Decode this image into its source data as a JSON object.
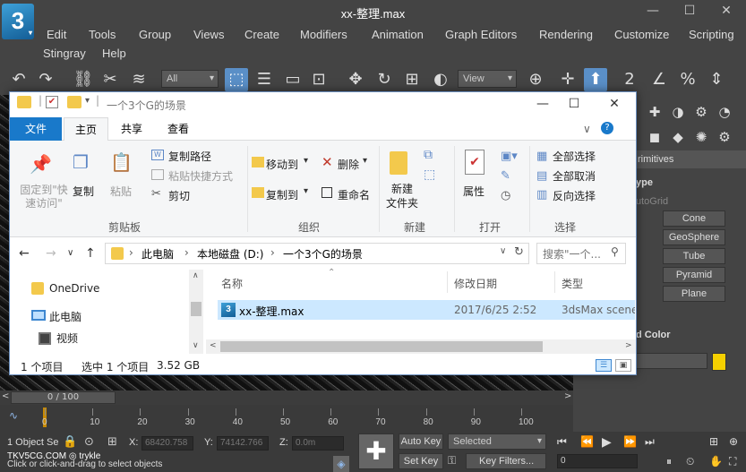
{
  "max": {
    "title": "xx-整理.max",
    "logo": "3",
    "window_controls": {
      "minimize": "—",
      "maximize": "☐",
      "close": "✕"
    },
    "menu": [
      "Edit",
      "Tools",
      "Group",
      "Views",
      "Create",
      "Modifiers",
      "Animation",
      "Graph Editors",
      "Rendering",
      "Customize",
      "Scripting",
      "Stingray",
      "Help"
    ],
    "toolbar": {
      "filter": "All",
      "view": "View"
    },
    "command_panel": {
      "rollout_primitives": "rimitives",
      "rollout_type": "ype",
      "autogrid": "utoGrid",
      "buttons": [
        "Cone",
        "GeoSphere",
        "Tube",
        "Pyramid",
        "Plane"
      ],
      "name_color": "d Color",
      "color_swatch": "#f5d000"
    },
    "timeslider": {
      "label": "0 / 100",
      "frame": 0,
      "frame_max": 100
    },
    "trackbar_ticks": [
      "0",
      "10",
      "20",
      "30",
      "40",
      "50",
      "60",
      "70",
      "80",
      "90",
      "100"
    ],
    "status": {
      "selection": "1 Object Se",
      "x_label": "X:",
      "x_value": "68420.758",
      "y_label": "Y:",
      "y_value": "74142.766",
      "z_label": "Z:",
      "z_value": "0.0m",
      "prompt": "Click or click-and-drag to select objects",
      "watermark": "TKV5CG.COM ◎ trykle",
      "auto_key": "Auto Key",
      "set_key": "Set Key",
      "selected": "Selected",
      "key_filters": "Key Filters...",
      "frame_field": "0"
    }
  },
  "explorer": {
    "title": "一个3个G的场景",
    "tabs": {
      "file": "文件",
      "home": "主页",
      "share": "共享",
      "view": "查看"
    },
    "ribbon": {
      "pin": "固定到\"快速访问\"",
      "copy": "复制",
      "paste": "粘贴",
      "copy_path": "复制路径",
      "paste_shortcut": "粘贴快捷方式",
      "cut": "剪切",
      "clipboard": "剪贴板",
      "move_to": "移动到",
      "delete": "删除",
      "copy_to": "复制到",
      "rename": "重命名",
      "organize": "组织",
      "new_folder": "新建\n文件夹",
      "new": "新建",
      "properties": "属性",
      "open": "打开",
      "select_all": "全部选择",
      "select_none": "全部取消",
      "invert_selection": "反向选择",
      "select": "选择"
    },
    "address": {
      "crumbs": [
        "此电脑",
        "本地磁盘 (D:)",
        "一个3个G的场景"
      ],
      "search_placeholder": "搜索\"一个..."
    },
    "nav": [
      "OneDrive",
      "此电脑",
      "视频"
    ],
    "columns": {
      "name": "名称",
      "date": "修改日期",
      "type": "类型"
    },
    "files": [
      {
        "name": "xx-整理.max",
        "date": "2017/6/25 2:52",
        "type": "3dsMax scene"
      }
    ],
    "statusbar": {
      "count": "1 个项目",
      "selected": "选中 1 个项目",
      "size": "3.52 GB"
    }
  }
}
